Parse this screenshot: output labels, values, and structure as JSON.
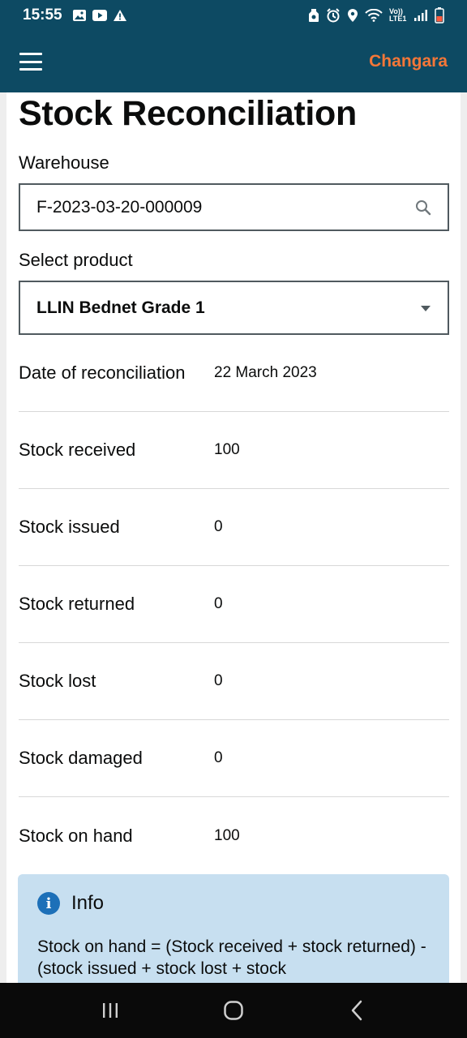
{
  "status_bar": {
    "time": "15:55",
    "network_label": "Vo)) LTE1",
    "left_icons": [
      "gallery-icon",
      "youtube-icon",
      "alert-icon"
    ],
    "right_icons": [
      "nfc-icon",
      "alarm-icon",
      "location-icon",
      "wifi-icon",
      "signal-icon",
      "battery-icon"
    ]
  },
  "app_bar": {
    "title": "Changara"
  },
  "page": {
    "title": "Stock Reconciliation"
  },
  "warehouse": {
    "label": "Warehouse",
    "value": "F-2023-03-20-000009"
  },
  "product": {
    "label": "Select product",
    "value": "LLIN Bednet Grade 1"
  },
  "details": [
    {
      "label": "Date of reconciliation",
      "value": "22 March 2023"
    },
    {
      "label": "Stock received",
      "value": "100"
    },
    {
      "label": "Stock issued",
      "value": "0"
    },
    {
      "label": "Stock returned",
      "value": "0"
    },
    {
      "label": "Stock lost",
      "value": "0"
    },
    {
      "label": "Stock damaged",
      "value": "0"
    },
    {
      "label": "Stock on hand",
      "value": "100"
    }
  ],
  "info": {
    "icon_glyph": "i",
    "title": "Info",
    "text": "Stock on hand = (Stock received + stock returned) - (stock issued + stock lost + stock"
  },
  "colors": {
    "primary": "#0d4a63",
    "accent": "#f47738",
    "info_bg": "#c7dff0",
    "info_icon": "#1d70b8"
  }
}
